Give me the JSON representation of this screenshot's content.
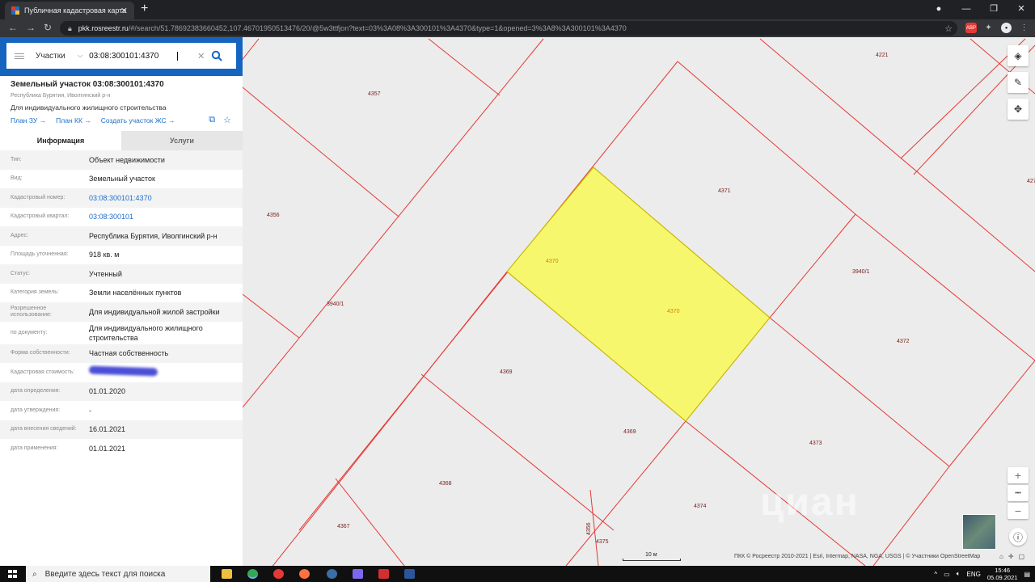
{
  "browser": {
    "tab_title": "Публичная кадастровая карта",
    "tab_close": "✕",
    "new_tab": "+",
    "url_host": "pkk.rosreestr.ru",
    "url_path": "/#/search/51.78692383660452,107.46701950513476/20/@5w3ttfjon?text=03%3A08%3A300101%3A4370&type=1&opened=3%3A8%3A300101%3A4370",
    "ext_abp": "ABP"
  },
  "search": {
    "type_label": "Участки",
    "query": "03:08:300101:4370"
  },
  "parcel": {
    "title": "Земельный участок 03:08:300101:4370",
    "region": "Республика Бурятия, Иволгинский р-н",
    "use": "Для индивидуального жилищного строительства",
    "links": [
      "План ЗУ →",
      "План КК →",
      "Создать участок ЖС →"
    ]
  },
  "tabs": {
    "info": "Информация",
    "services": "Услуги"
  },
  "rows": [
    {
      "label": "Тип:",
      "value": "Объект недвижимости"
    },
    {
      "label": "Вид:",
      "value": "Земельный участок"
    },
    {
      "label": "Кадастровый номер:",
      "value": "03:08:300101:4370"
    },
    {
      "label": "Кадастровый квартал:",
      "value": "03:08:300101"
    },
    {
      "label": "Адрес:",
      "value": "Республика Бурятия, Иволгинский р-н"
    },
    {
      "label": "Площадь уточненная:",
      "value": "918 кв. м"
    },
    {
      "label": "Статус:",
      "value": "Учтенный"
    },
    {
      "label": "Категория земель:",
      "value": "Земли населённых пунктов"
    },
    {
      "label": "Разрешенное использование:",
      "value": "Для индивидуальной жилой застройки"
    },
    {
      "label": "по документу:",
      "value": "Для индивидуального жилищного строительства"
    },
    {
      "label": "Форма собственности:",
      "value": "Частная собственность"
    },
    {
      "label": "Кадастровая стоимость:",
      "value": ""
    },
    {
      "label": "дата определения:",
      "value": "01.01.2020"
    },
    {
      "label": "дата утверждения:",
      "value": "-"
    },
    {
      "label": "дата внесения сведений:",
      "value": "16.01.2021"
    },
    {
      "label": "дата применения:",
      "value": "01.01.2021"
    }
  ],
  "map": {
    "labels": {
      "l4357": "4357",
      "l4356": "4356",
      "l4221": "4221",
      "l4371": "4371",
      "l4370a": "4370",
      "l4370b": "4370",
      "l3940a": "3940/1",
      "l3940b": "3940/1",
      "l4372": "4372",
      "l4369a": "4369",
      "l4369b": "4369",
      "l4373": "4373",
      "l4368": "4368",
      "l4374": "4374",
      "l4367": "4367",
      "l4375": "4375",
      "l4356b": "4356",
      "l427": "427"
    },
    "scale": "10 м",
    "attribution": "ПКК © Росреестр 2010-2021 | Esri, Intermap, NASA, NGA, USGS | © Участники OpenStreetMap",
    "watermark": "циан",
    "zoom_in": "+",
    "zoom_more": "•••",
    "zoom_out": "−",
    "colors": {
      "border": "#e53935",
      "selected_fill": "#f7f76e",
      "selected_border": "#c9b800"
    }
  },
  "taskbar": {
    "search_placeholder": "Введите здесь текст для поиска",
    "lang": "ENG",
    "time": "15:46",
    "date": "05.09.2021"
  }
}
